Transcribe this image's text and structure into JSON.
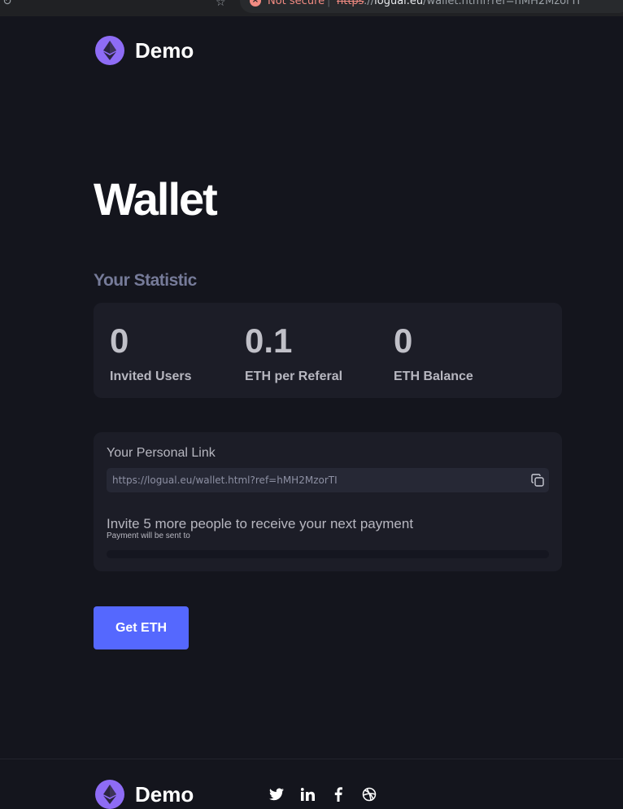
{
  "browser": {
    "security_label": "Not secure",
    "separator": "|",
    "url_scheme": "https",
    "url_sep": "://",
    "url_host": "logual.eu",
    "url_path": "/wallet.html?ref=hMH2MzorTI"
  },
  "brand": {
    "name": "Demo",
    "icon": "ethereum-icon",
    "color": "#8e6cf5"
  },
  "page": {
    "title": "Wallet",
    "subtitle": "Your Statistic"
  },
  "stats": [
    {
      "value": "0",
      "label": "Invited Users"
    },
    {
      "value": "0.1",
      "label": "ETH per Referal"
    },
    {
      "value": "0",
      "label": "ETH Balance"
    }
  ],
  "personal_link": {
    "title": "Your Personal Link",
    "url": "https://logual.eu/wallet.html?ref=hMH2MzorTI",
    "copy_icon": "copy-icon",
    "invite_text": "Invite 5 more people to receive your next payment",
    "payment_note": "Payment will be sent to",
    "progress": 0
  },
  "cta": {
    "label": "Get ETH",
    "color": "#5568fe"
  },
  "footer": {
    "brand": "Demo",
    "socials": [
      "twitter-icon",
      "linkedin-icon",
      "facebook-icon",
      "dribbble-icon"
    ]
  }
}
